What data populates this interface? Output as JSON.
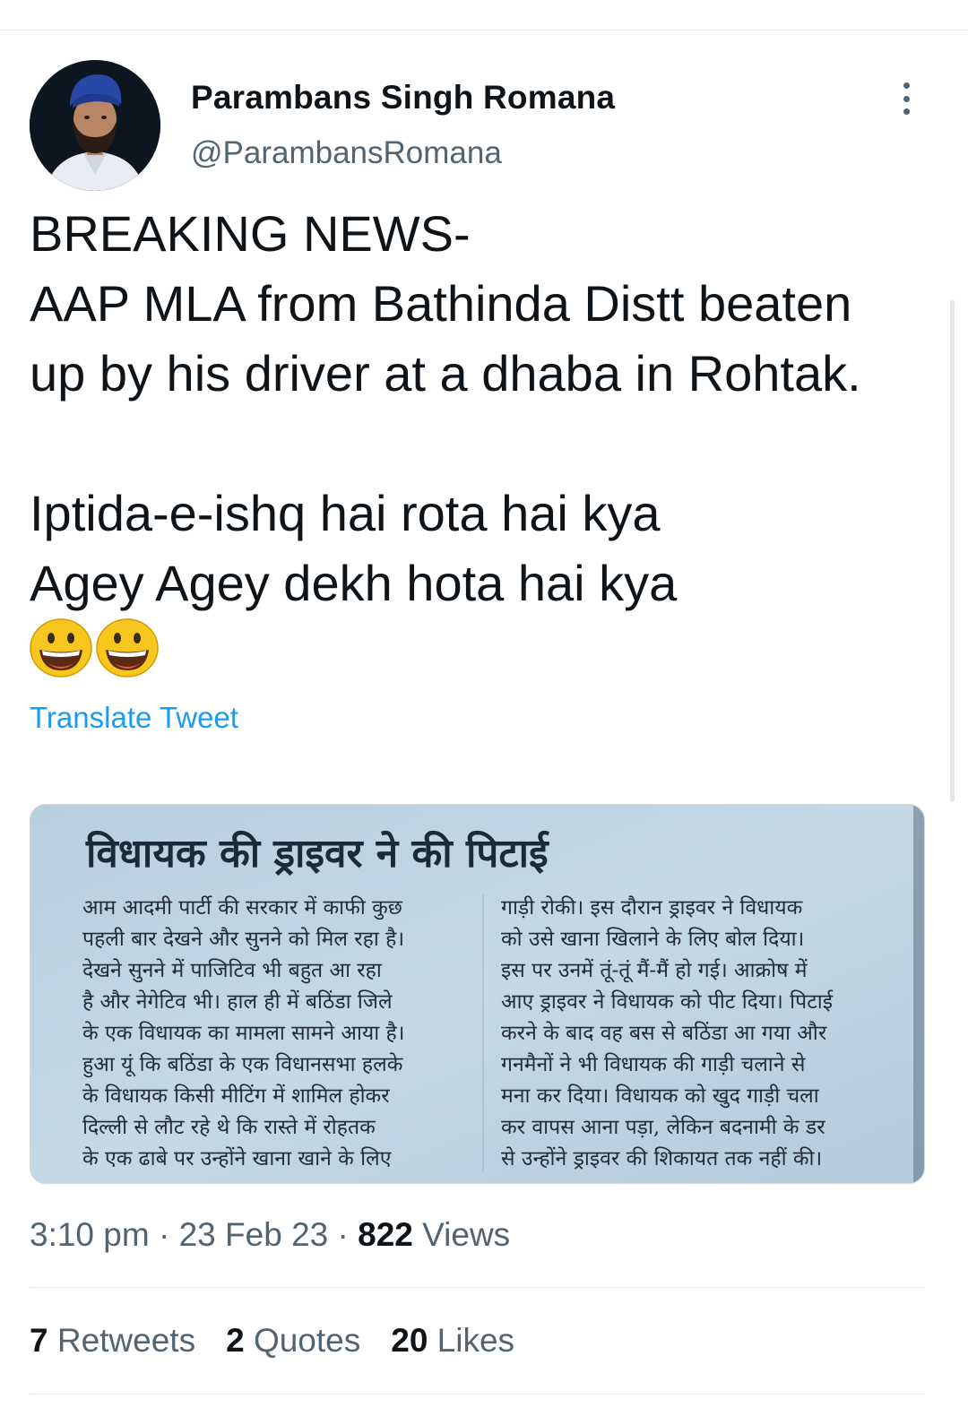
{
  "author": {
    "display_name": "Parambans Singh Romana",
    "handle": "@ParambansRomana"
  },
  "tweet": {
    "lines": [
      "BREAKING NEWS-",
      "AAP MLA from Bathinda Distt beaten",
      "up by his driver at a dhaba in Rohtak.",
      "",
      "Iptida-e-ishq hai rota hai kya",
      "Agey Agey dekh hota hai kya"
    ],
    "emoji_count": 2,
    "translate_label": "Translate Tweet"
  },
  "media": {
    "headline": "विधायक की ड्राइवर ने की पिटाई",
    "left_column": [
      "आम आदमी पार्टी की सरकार में काफी कुछ",
      "पहली बार देखने और सुनने को मिल रहा है।",
      "देखने सुनने में पाजिटिव भी बहुत आ रहा",
      "है और नेगेटिव भी। हाल ही में बठिंडा जिले",
      "के एक विधायक का मामला सामने आया है।",
      "हुआ यूं कि बठिंडा के एक विधानसभा हलके",
      "के विधायक किसी मीटिंग में शामिल होकर",
      "दिल्ली से लौट रहे थे कि रास्ते में रोहतक",
      "के एक ढाबे पर उन्होंने खाना खाने के लिए"
    ],
    "right_column": [
      "गाड़ी रोकी। इस दौरान ड्राइवर ने विधायक",
      "को उसे खाना खिलाने के लिए बोल दिया।",
      "इस पर उनमें तूं-तूं मैं-मैं हो गई। आक्रोष में",
      "आए ड्राइवर ने विधायक को पीट दिया। पिटाई",
      "करने के बाद वह बस से बठिंडा आ गया और",
      "गनमैनों ने भी विधायक की गाड़ी चलाने से",
      "मना कर दिया। विधायक को खुद गाड़ी चला",
      "कर वापस आना पड़ा, लेकिन बदनामी के डर",
      "से उन्होंने ड्राइवर की शिकायत तक नहीं की।"
    ]
  },
  "meta": {
    "time": "3:10 pm",
    "sep1": " · ",
    "date": "23 Feb 23",
    "sep2": " · ",
    "views_count": "822",
    "views_label": " Views"
  },
  "stats": {
    "retweets_count": "7",
    "retweets_label": " Retweets",
    "quotes_count": "2",
    "quotes_label": " Quotes",
    "likes_count": "20",
    "likes_label": " Likes"
  },
  "colors": {
    "link": "#1d9bf0",
    "secondary_text": "#536471",
    "primary_text": "#0f1419"
  }
}
